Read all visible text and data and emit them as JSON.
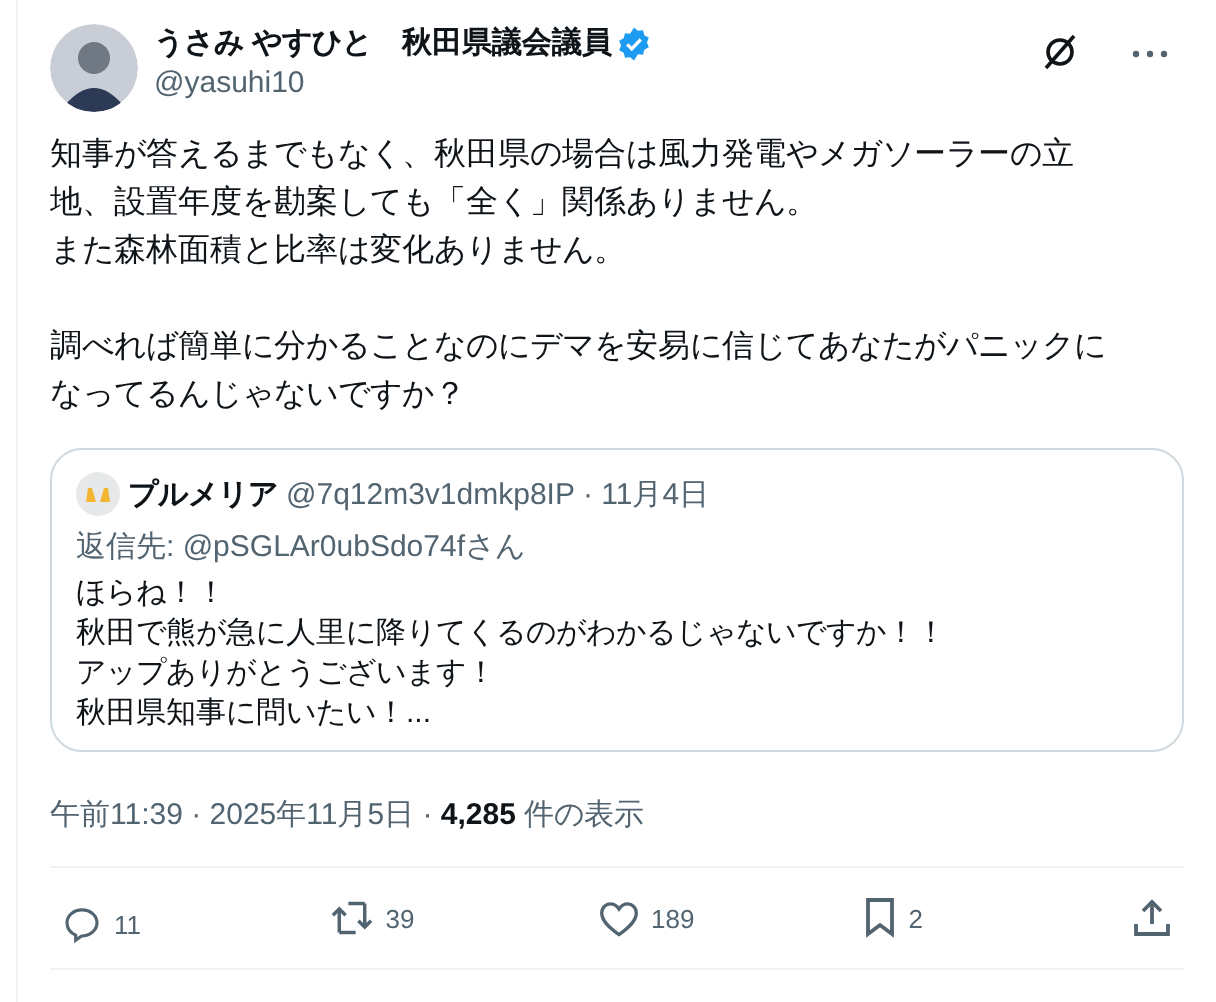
{
  "author": {
    "name": "うさみ やすひと　秋田県議会議員",
    "verified": true,
    "handle": "@yasuhi10"
  },
  "body": [
    [
      "知事が答えるまでもなく、秋田県の場合は風力発電やメガソーラーの立",
      "地、設置年度を勘案しても「全く」関係ありません。",
      "また森林面積と比率は変化ありません。"
    ],
    [
      "調べれば簡単に分かることなのにデマを安易に信じてあなたがパニックに",
      "なってるんじゃないですか？"
    ]
  ],
  "quote": {
    "name": "プルメリア",
    "handle": "@7q12m3v1dmkp8IP",
    "date": "· 11月4日",
    "reply_to": "返信先: @pSGLAr0ubSdo74fさん",
    "lines": [
      "ほらね！！",
      "秋田で熊が急に人里に降りてくるのがわかるじゃないですか！！",
      "アップありがとうございます！",
      "秋田県知事に問いたい！..."
    ]
  },
  "meta": "午前11:39 · 2025年11月5日 · **4,285** 件の表示",
  "actions": [
    {
      "kind": "reply",
      "count": "11"
    },
    {
      "kind": "retweet",
      "count": "39"
    },
    {
      "kind": "like",
      "count": "189"
    },
    {
      "kind": "bookmark",
      "count": "2"
    },
    {
      "kind": "share"
    }
  ]
}
